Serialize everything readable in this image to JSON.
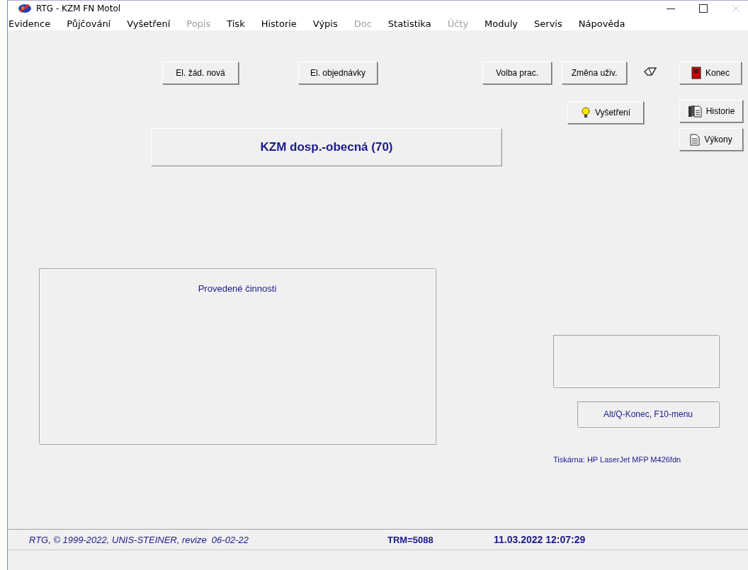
{
  "window": {
    "title": "RTG - KZM FN Motol"
  },
  "menu": [
    {
      "label": "Evidence",
      "disabled": false
    },
    {
      "label": "Půjčování",
      "disabled": false
    },
    {
      "label": "Vyšetření",
      "disabled": false
    },
    {
      "label": "Popis",
      "disabled": true
    },
    {
      "label": "Tisk",
      "disabled": false
    },
    {
      "label": "Historie",
      "disabled": false
    },
    {
      "label": "Výpis",
      "disabled": false
    },
    {
      "label": "Doc",
      "disabled": true
    },
    {
      "label": "Statistika",
      "disabled": false
    },
    {
      "label": "Účty",
      "disabled": true
    },
    {
      "label": "Moduly",
      "disabled": false
    },
    {
      "label": "Servis",
      "disabled": false
    },
    {
      "label": "Nápověda",
      "disabled": false
    }
  ],
  "toolbar": [
    {
      "label": "El. žád. nová",
      "kind": "text"
    },
    {
      "label": "El. objednávky",
      "kind": "text"
    },
    {
      "label": "Volba prac.",
      "kind": "text"
    },
    {
      "label": "Změna uživ.",
      "kind": "text"
    },
    {
      "kind": "eraser"
    },
    {
      "label": "Konec",
      "kind": "exit"
    }
  ],
  "side_buttons": [
    {
      "label": "Vyšetření",
      "kind": "bulb"
    },
    {
      "label": "Historie",
      "kind": "books"
    },
    {
      "label": "Výkony",
      "kind": "document"
    }
  ],
  "workplace": "KZM dosp.-obecná (70)",
  "activities_panel": {
    "title": "Provedené činnosti"
  },
  "hint": "Alt/Q-Konec, F10-menu",
  "printer": "Tiskárna: HP LaserJet MFP M426fdn",
  "status_bar": {
    "copyright": "RTG, © 1999-2022, UNIS-STEINER, revize  06-02-22",
    "terminal": "TRM=5088",
    "datetime": "11.03.2022 12:07:29"
  }
}
